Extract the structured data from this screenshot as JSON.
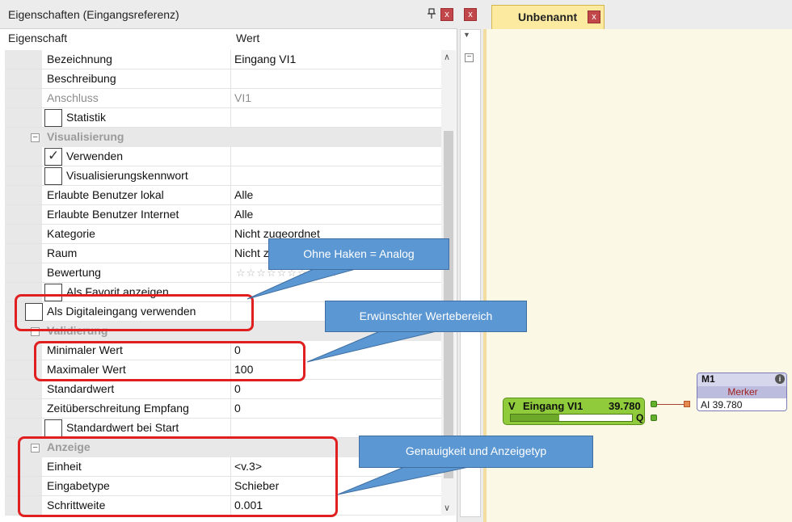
{
  "panel": {
    "title": "Eigenschaften (Eingangsreferenz)",
    "close_label": "x",
    "columns": {
      "property": "Eigenschaft",
      "value": "Wert"
    }
  },
  "rows": {
    "bezeichnung": {
      "label": "Bezeichnung",
      "value": "Eingang VI1"
    },
    "beschreibung": {
      "label": "Beschreibung",
      "value": ""
    },
    "anschluss": {
      "label": "Anschluss",
      "value": "VI1"
    },
    "statistik": {
      "label": "Statistik",
      "checked": false
    },
    "sec_visualisierung": {
      "label": "Visualisierung",
      "toggle": "−"
    },
    "verwenden": {
      "label": "Verwenden",
      "checked": true,
      "tick": "✓"
    },
    "viskennwort": {
      "label": "Visualisierungskennwort",
      "checked": false
    },
    "benutzer_lokal": {
      "label": "Erlaubte Benutzer lokal",
      "value": "Alle"
    },
    "benutzer_internet": {
      "label": "Erlaubte Benutzer Internet",
      "value": "Alle"
    },
    "kategorie": {
      "label": "Kategorie",
      "value": "Nicht zugeordnet"
    },
    "raum": {
      "label": "Raum",
      "value": "Nicht z"
    },
    "bewertung": {
      "label": "Bewertung",
      "stars": "☆☆☆☆☆☆☆☆☆☆"
    },
    "favorit": {
      "label": "Als Favorit anzeigen",
      "checked": false
    },
    "digital": {
      "label": "Als Digitaleingang verwenden",
      "checked": false
    },
    "sec_validierung": {
      "label": "Validierung",
      "toggle": "−"
    },
    "min": {
      "label": "Minimaler Wert",
      "value": "0"
    },
    "max": {
      "label": "Maximaler Wert",
      "value": "100"
    },
    "standard": {
      "label": "Standardwert",
      "value": "0"
    },
    "timeout": {
      "label": "Zeitüberschreitung Empfang",
      "value": "0"
    },
    "standard_start": {
      "label": "Standardwert bei Start",
      "checked": false
    },
    "sec_anzeige": {
      "label": "Anzeige",
      "toggle": "−"
    },
    "einheit": {
      "label": "Einheit",
      "value": "<v.3>"
    },
    "eingabetyp": {
      "label": "Eingabetype",
      "value": "Schieber"
    },
    "schrittweite": {
      "label": "Schrittweite",
      "value": "0.001"
    }
  },
  "strip": {
    "close_label": "x",
    "arrow": "▼",
    "tree_toggle": "−"
  },
  "document_tab": {
    "label": "Unbenannt",
    "close_label": "x"
  },
  "canvas": {
    "input_block": {
      "type_letter": "V",
      "name": "Eingang VI1",
      "value": "39.780",
      "output_q": "Q",
      "level_fraction": 0.3978
    },
    "memory_block": {
      "name": "M1",
      "info": "i",
      "type": "Merker",
      "input": "AI 39.780"
    }
  },
  "callouts": {
    "analog": "Ohne Haken = Analog",
    "range": "Erwünschter Wertebereich",
    "precision": "Genauigkeit und Anzeigetyp"
  },
  "scroll": {
    "up": "∧",
    "down": "∨"
  },
  "icons": {
    "pin": "pin-icon",
    "close": "close-icon",
    "checkmark": "checkmark-icon",
    "collapse": "collapse-icon",
    "info": "info-icon"
  },
  "colors": {
    "callout": "#5b97d2",
    "highlight": "#e02020",
    "block_green": "#8fcb3a",
    "tab_yellow": "#fbeaa0",
    "canvas": "#fbf8e6"
  }
}
